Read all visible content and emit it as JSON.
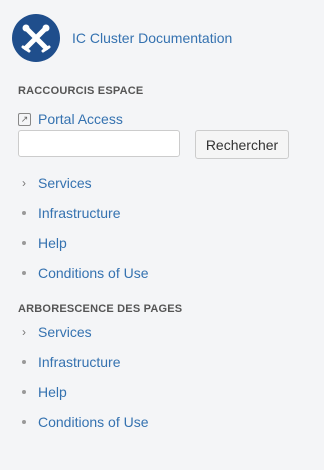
{
  "space": {
    "title": "IC Cluster Documentation"
  },
  "shortcuts": {
    "heading": "RACCOURCIS ESPACE",
    "portal_label": "Portal Access",
    "search_placeholder": "",
    "search_button": "Rechercher",
    "items": [
      {
        "label": "Services",
        "marker": "chevron"
      },
      {
        "label": "Infrastructure",
        "marker": "dot"
      },
      {
        "label": "Help",
        "marker": "dot"
      },
      {
        "label": "Conditions of Use",
        "marker": "dot"
      }
    ]
  },
  "tree": {
    "heading": "ARBORESCENCE DES PAGES",
    "items": [
      {
        "label": "Services",
        "marker": "chevron"
      },
      {
        "label": "Infrastructure",
        "marker": "dot"
      },
      {
        "label": "Help",
        "marker": "dot"
      },
      {
        "label": "Conditions of Use",
        "marker": "dot"
      }
    ]
  },
  "colors": {
    "link": "#3572b0",
    "logo_bg": "#1f4e8c",
    "background": "#f4f5f7"
  }
}
